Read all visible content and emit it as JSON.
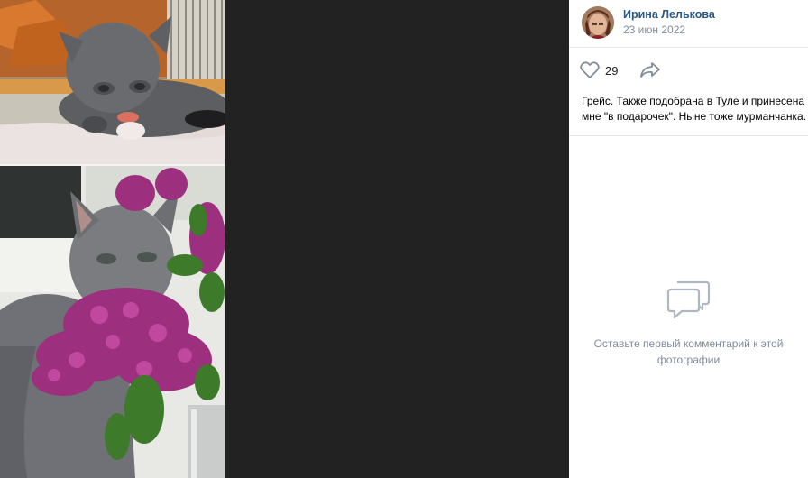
{
  "author": {
    "name": "Ирина Лелькова",
    "date": "23 июн 2022",
    "avatar_icon": "user-avatar"
  },
  "actions": {
    "like_count": "29",
    "like_icon": "heart-outline-icon",
    "share_icon": "share-arrow-icon"
  },
  "post": {
    "description": "Грейс. Также подобрана в Туле и принесена мне \"в подарочек\". Ныне тоже мурманчанка."
  },
  "comments": {
    "empty_text": "Оставьте первый комментарий к этой фотографии",
    "icon": "comment-bubbles-icon"
  },
  "colors": {
    "viewer_bg": "#222222",
    "link": "#2a5885",
    "muted": "#818c99",
    "divider": "#e7e8ec"
  }
}
